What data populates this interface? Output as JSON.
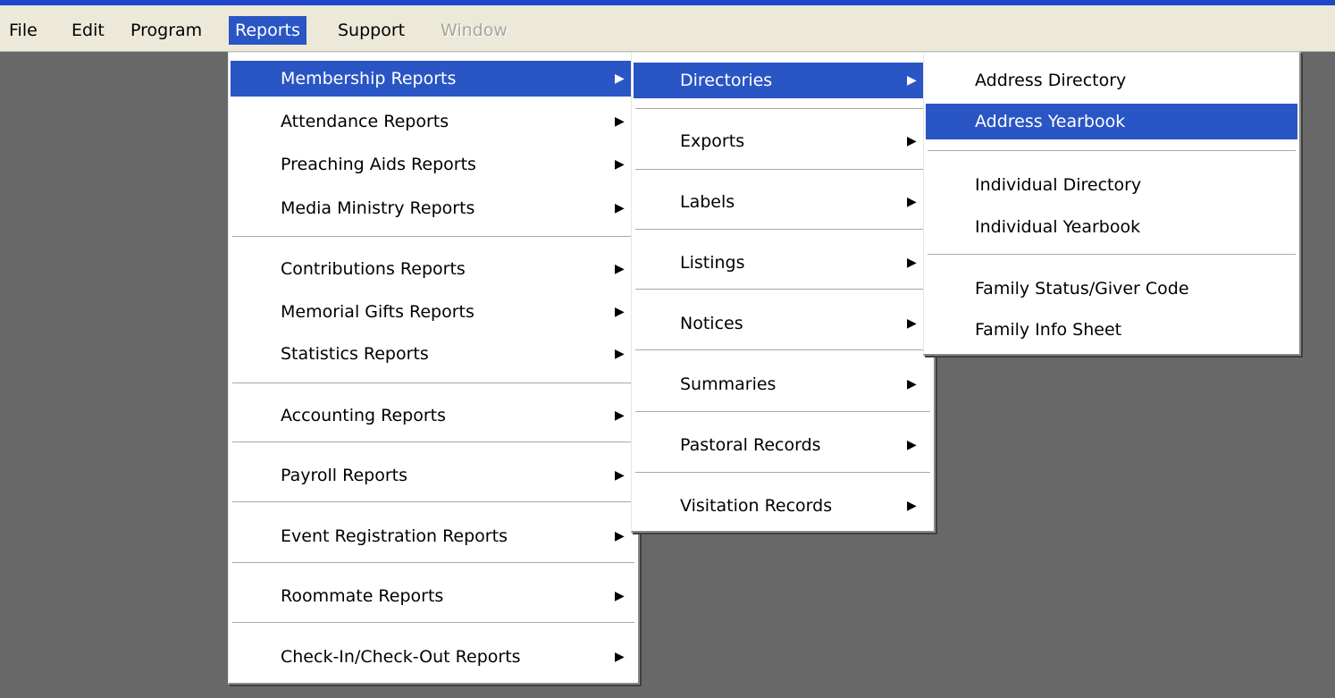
{
  "menubar": {
    "file": "File",
    "edit": "Edit",
    "program": "Program",
    "reports": "Reports",
    "support": "Support",
    "window": "Window"
  },
  "reports_menu": [
    "Membership Reports",
    "Attendance Reports",
    "Preaching Aids Reports",
    "Media Ministry Reports",
    "Contributions Reports",
    "Memorial Gifts Reports",
    "Statistics Reports",
    "Accounting Reports",
    "Payroll Reports",
    "Event Registration Reports",
    "Roommate Reports",
    "Check-In/Check-Out Reports"
  ],
  "membership_menu": [
    "Directories",
    "Exports",
    "Labels",
    "Listings",
    "Notices",
    "Summaries",
    "Pastoral Records",
    "Visitation Records"
  ],
  "directories_menu": [
    "Address Directory",
    "Address Yearbook",
    "Individual Directory",
    "Individual Yearbook",
    "Family Status/Giver Code",
    "Family Info Sheet"
  ],
  "icons": {
    "submenu_arrow": "submenu-arrow-icon"
  }
}
